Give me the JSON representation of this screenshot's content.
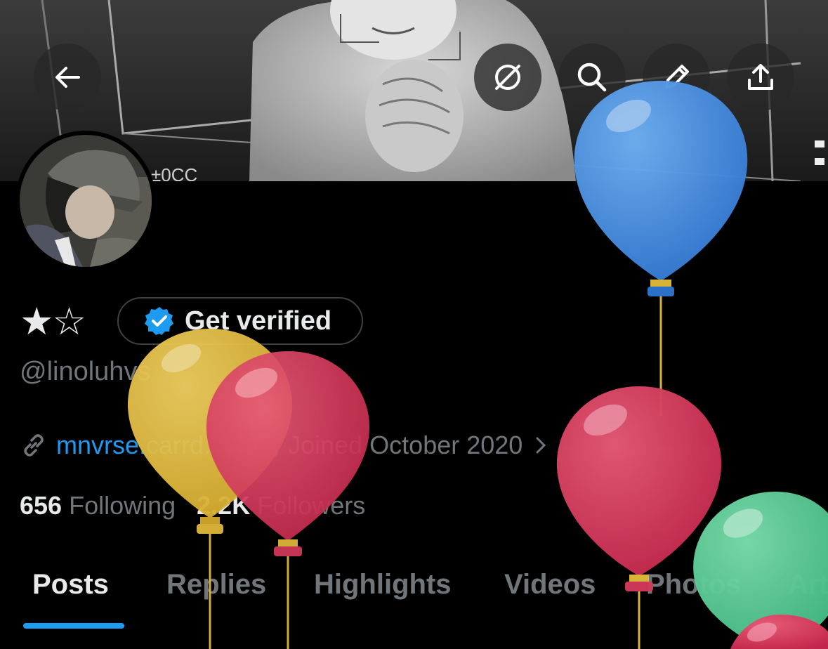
{
  "header": {
    "back_icon": "arrow-left-icon",
    "actions": [
      "grok-icon",
      "search-icon",
      "edit-icon",
      "share-icon"
    ]
  },
  "banner": {
    "caption_text": "±0CC"
  },
  "profile": {
    "display_name": "★☆",
    "verify_label": "Get verified",
    "handle": "@linoluhvs",
    "link_text": "mnvrse.carrd.co",
    "joined_text": "Joined October 2020",
    "following_count": "656",
    "following_label": "Following",
    "followers_count": "2.2K",
    "followers_label": "Followers"
  },
  "tabs": [
    {
      "label": "Posts",
      "active": true
    },
    {
      "label": "Replies"
    },
    {
      "label": "Highlights"
    },
    {
      "label": "Videos"
    },
    {
      "label": "Photos"
    },
    {
      "label": "Articles"
    }
  ],
  "colors": {
    "accent": "#1d9bf0",
    "muted": "#71767b",
    "text": "#e7e9ea",
    "balloon_blue": "#3b82dc",
    "balloon_red": "#d23a5a",
    "balloon_yellow": "#e0b83a",
    "balloon_green": "#55c993"
  }
}
